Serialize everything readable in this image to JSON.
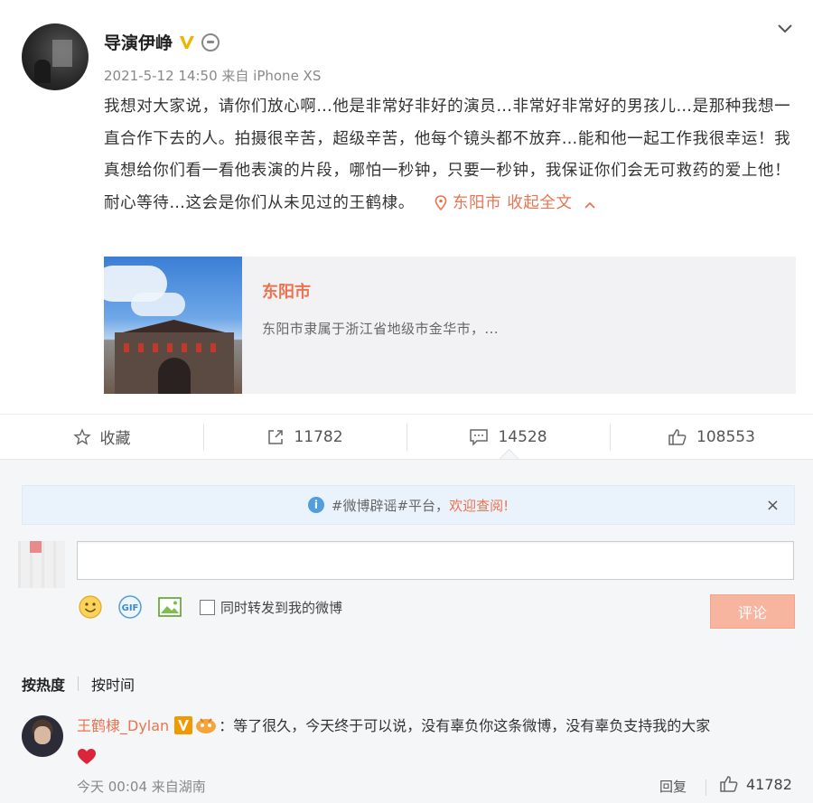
{
  "post": {
    "author": "导演伊峥",
    "meta": "2021-5-12 14:50 来自 iPhone XS",
    "content": "我想对大家说，请你们放心啊…他是非常好非好的演员…非常好非常好的男孩儿…是那种我想一直合作下去的人。拍摄很辛苦，超级辛苦，他每个镜头都不放弃…能和他一起工作我很幸运！我真想给你们看一看他表演的片段，哪怕一秒钟，只要一秒钟，我保证你们会无可救药的爱上他！耐心等待…这会是你们从未见过的王鹤棣。",
    "location": "东阳市",
    "collapse": "收起全文"
  },
  "card": {
    "title": "东阳市",
    "desc": "东阳市隶属于浙江省地级市金华市，..."
  },
  "actions": {
    "favorite": "收藏",
    "repost": "11782",
    "comment": "14528",
    "like": "108553"
  },
  "notice": {
    "text": "#微博辟谣#平台，",
    "highlight": "欢迎查阅!",
    "close": "×"
  },
  "composer": {
    "input_value": "",
    "repost_label": "同时转发到我的微博",
    "submit_label": "评论"
  },
  "sort": {
    "hot": "按热度",
    "time": "按时间"
  },
  "comment": {
    "name": "王鹤棣_Dylan",
    "text": "：等了很久，今天终于可以说，没有辜负你这条微博，没有辜负支持我的大家",
    "time": "今天 00:04 来自湖南",
    "reply": "回复",
    "likes": "41782"
  }
}
